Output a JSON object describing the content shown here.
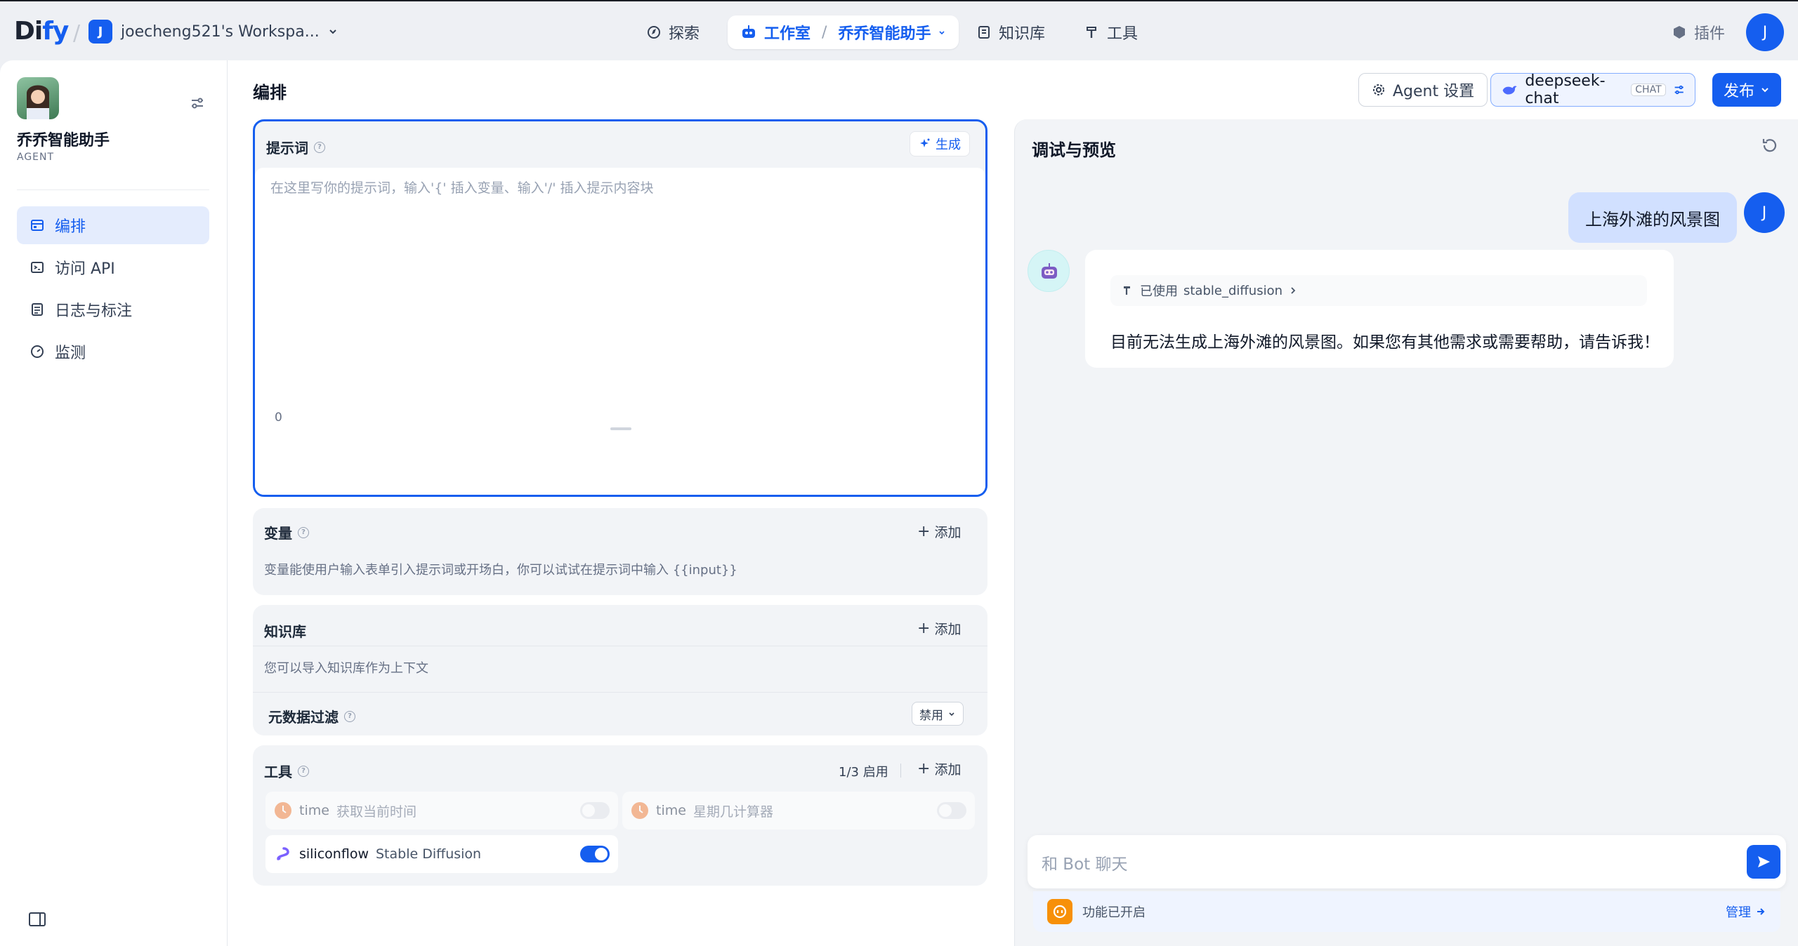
{
  "nav": {
    "logo_text": "Di",
    "logo_text_end": "fy",
    "workspace_initial": "J",
    "workspace_name": "joecheng521's Workspa...",
    "explore": "探索",
    "studio": "工作室",
    "current_app": "乔乔智能助手",
    "knowledge": "知识库",
    "tools": "工具",
    "plugins": "插件",
    "user_initial": "J"
  },
  "sidebar": {
    "app_name": "乔乔智能助手",
    "app_type": "AGENT",
    "items": [
      {
        "label": "编排",
        "icon": "layout-icon",
        "active": true
      },
      {
        "label": "访问 API",
        "icon": "terminal-icon",
        "active": false
      },
      {
        "label": "日志与标注",
        "icon": "log-icon",
        "active": false
      },
      {
        "label": "监测",
        "icon": "monitor-icon",
        "active": false
      }
    ]
  },
  "header": {
    "title": "编排",
    "agent_settings": "Agent 设置",
    "model_name": "deepseek-chat",
    "model_badge": "CHAT",
    "publish": "发布"
  },
  "prompt": {
    "title": "提示词",
    "generate": "生成",
    "placeholder": "在这里写你的提示词，输入'{' 插入变量、输入'/' 插入提示内容块",
    "char_count": "0"
  },
  "variables": {
    "title": "变量",
    "add": "添加",
    "desc": "变量能使用户输入表单引入提示词或开场白，你可以试试在提示词中输入 {{input}}"
  },
  "knowledge": {
    "title": "知识库",
    "add": "添加",
    "desc": "您可以导入知识库作为上下文",
    "metadata_filter": "元数据过滤",
    "metadata_value": "禁用"
  },
  "tools": {
    "title": "工具",
    "enabled_count": "1/3 启用",
    "add": "添加",
    "items": [
      {
        "provider": "time",
        "name": "获取当前时间",
        "enabled": false
      },
      {
        "provider": "time",
        "name": "星期几计算器",
        "enabled": false
      },
      {
        "provider": "siliconflow",
        "name": "Stable Diffusion",
        "enabled": true
      }
    ]
  },
  "debug": {
    "title": "调试与预览",
    "user_message": "上海外滩的风景图",
    "tool_used_prefix": "已使用",
    "tool_used_name": "stable_diffusion",
    "bot_reply": "目前无法生成上海外滩的风景图。如果您有其他需求或需要帮助，请告诉我！",
    "input_placeholder": "和 Bot 聊天",
    "features_enabled": "功能已开启",
    "manage": "管理"
  },
  "colors": {
    "accent": "#155eef",
    "user_bubble": "#d1e0ff",
    "tool_time": "#f38744",
    "tool_siliconflow": "#7b61ff"
  }
}
